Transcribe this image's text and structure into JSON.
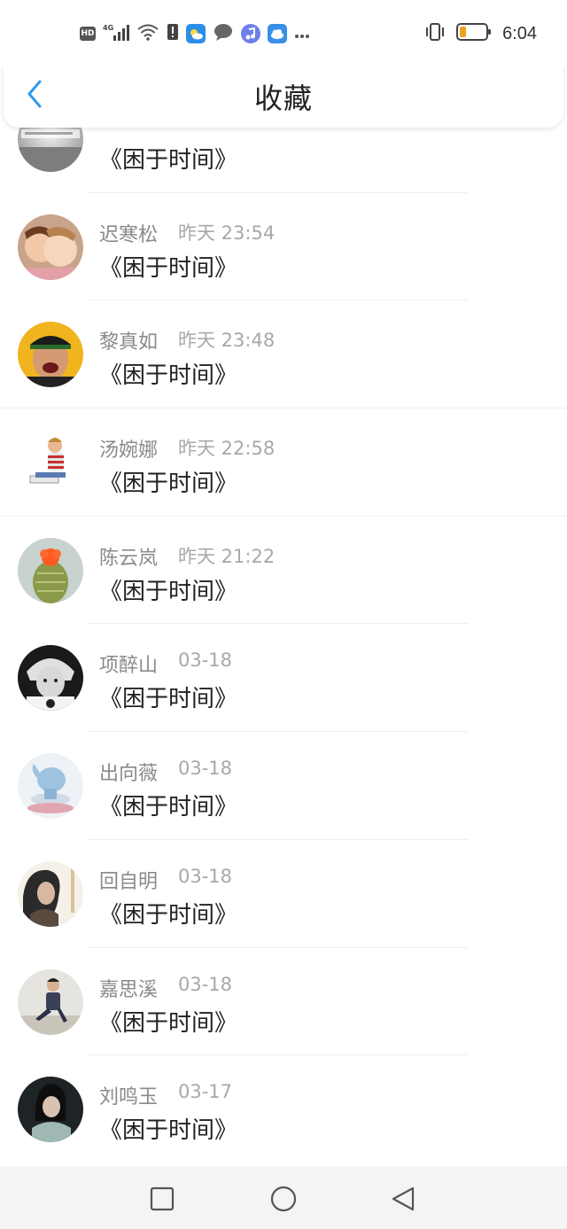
{
  "status_bar": {
    "hd": "HD",
    "network": "4G",
    "time": "6:04"
  },
  "header": {
    "title": "收藏"
  },
  "items": [
    {
      "name": "",
      "time": "",
      "content": "《困于时间》",
      "avatar": "gray-text-avatar"
    },
    {
      "name": "迟寒松",
      "time": "昨天 23:54",
      "content": "《困于时间》",
      "avatar": "kids-avatar"
    },
    {
      "name": "黎真如",
      "time": "昨天 23:48",
      "content": "《困于时间》",
      "avatar": "crying-man-avatar"
    },
    {
      "name": "汤婉娜",
      "time": "昨天 22:58",
      "content": "《困于时间》",
      "avatar": "reading-boy-avatar"
    },
    {
      "name": "陈云岚",
      "time": "昨天 21:22",
      "content": "《困于时间》",
      "avatar": "cactus-avatar"
    },
    {
      "name": "项醉山",
      "time": "03-18",
      "content": "《困于时间》",
      "avatar": "bw-portrait-avatar"
    },
    {
      "name": "出向薇",
      "time": "03-18",
      "content": "《困于时间》",
      "avatar": "whale-toy-avatar"
    },
    {
      "name": "回自明",
      "time": "03-18",
      "content": "《困于时间》",
      "avatar": "woman-portrait-avatar"
    },
    {
      "name": "嘉思溪",
      "time": "03-18",
      "content": "《困于时间》",
      "avatar": "man-sitting-avatar"
    },
    {
      "name": "刘鸣玉",
      "time": "03-17",
      "content": "《困于时间》",
      "avatar": "dark-portrait-avatar"
    }
  ],
  "colors": {
    "accent": "#2f9be8",
    "name": "#8a8a8a",
    "time": "#a8a8a8"
  }
}
